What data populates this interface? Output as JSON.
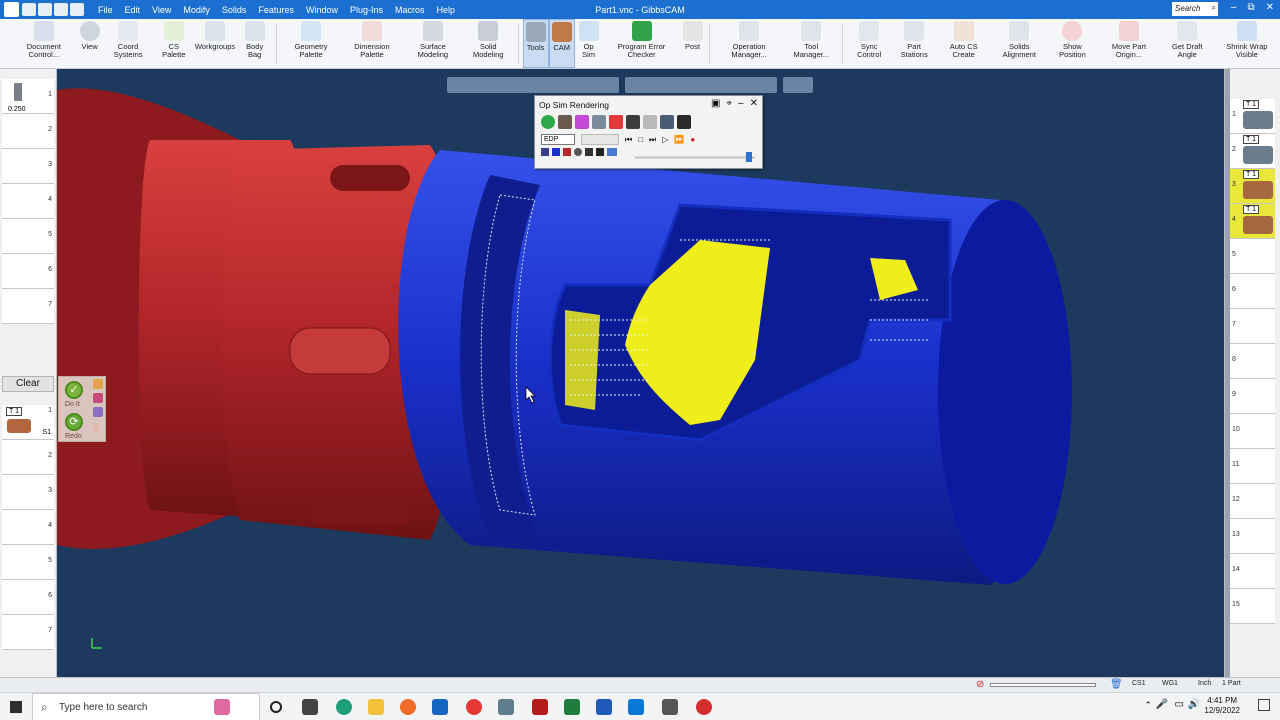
{
  "titlebar": {
    "window_title": "Part1.vnc - GibbsCAM",
    "menu": [
      "File",
      "Edit",
      "View",
      "Modify",
      "Solids",
      "Features",
      "Window",
      "Plug-Ins",
      "Macros",
      "Help"
    ],
    "search_placeholder": "Search"
  },
  "ribbon": {
    "buttons": [
      {
        "label": "Document Control...",
        "icon": "document-icon"
      },
      {
        "label": "View",
        "icon": "view-icon"
      },
      {
        "label": "Coord Systems",
        "icon": "coord-icon"
      },
      {
        "label": "CS Palette",
        "icon": "cs-palette-icon"
      },
      {
        "label": "Workgroups",
        "icon": "workgroups-icon"
      },
      {
        "label": "Body Bag",
        "icon": "body-bag-icon"
      },
      {
        "label": "Geometry Palette",
        "icon": "geometry-icon"
      },
      {
        "label": "Dimension Palette",
        "icon": "dimension-icon"
      },
      {
        "label": "Surface Modeling",
        "icon": "surface-icon"
      },
      {
        "label": "Solid Modeling",
        "icon": "solid-icon"
      },
      {
        "label": "Tools",
        "icon": "tools-icon"
      },
      {
        "label": "CAM",
        "icon": "cam-icon"
      },
      {
        "label": "Op Sim",
        "icon": "opsim-icon"
      },
      {
        "label": "Program Error Checker",
        "icon": "checker-icon"
      },
      {
        "label": "Post",
        "icon": "post-icon"
      },
      {
        "label": "Operation Manager...",
        "icon": "op-manager-icon"
      },
      {
        "label": "Tool Manager...",
        "icon": "tool-manager-icon"
      },
      {
        "label": "Sync Control",
        "icon": "sync-icon"
      },
      {
        "label": "Part Stations",
        "icon": "part-stations-icon"
      },
      {
        "label": "Auto CS Create",
        "icon": "auto-cs-icon"
      },
      {
        "label": "Solids Alignment",
        "icon": "align-icon"
      },
      {
        "label": "Show Position",
        "icon": "crosshair-icon"
      },
      {
        "label": "Move Part Origin...",
        "icon": "move-origin-icon"
      },
      {
        "label": "Get Draft Angle",
        "icon": "draft-icon"
      },
      {
        "label": "Shrink Wrap Visible",
        "icon": "shrink-wrap-icon"
      }
    ]
  },
  "left_panel": {
    "tool_diameter": "0.250",
    "slot_numbers": [
      "1",
      "2",
      "3",
      "4",
      "5",
      "6",
      "7"
    ],
    "clear_label": "Clear",
    "lower_slot_numbers": [
      "1",
      "2",
      "3",
      "4",
      "5",
      "6",
      "7"
    ],
    "tool_label": "T 1",
    "spindle_label": "S1"
  },
  "doit": {
    "do_it_label": "Do It",
    "redo_label": "Redo"
  },
  "right_panel": {
    "slots": [
      {
        "num": "1",
        "tool": "T 1",
        "color": "#ffffff"
      },
      {
        "num": "2",
        "tool": "T 1",
        "color": "#ffffff"
      },
      {
        "num": "3",
        "tool": "T 1",
        "color": "#e9e83a"
      },
      {
        "num": "4",
        "tool": "T 1",
        "color": "#e9e83a"
      },
      {
        "num": "5",
        "tool": "",
        "color": "#ffffff"
      },
      {
        "num": "6",
        "tool": "",
        "color": "#ffffff"
      },
      {
        "num": "7",
        "tool": "",
        "color": "#ffffff"
      },
      {
        "num": "8",
        "tool": "",
        "color": "#ffffff"
      },
      {
        "num": "9",
        "tool": "",
        "color": "#ffffff"
      },
      {
        "num": "10",
        "tool": "",
        "color": "#ffffff"
      },
      {
        "num": "11",
        "tool": "",
        "color": "#ffffff"
      },
      {
        "num": "12",
        "tool": "",
        "color": "#ffffff"
      },
      {
        "num": "13",
        "tool": "",
        "color": "#ffffff"
      },
      {
        "num": "14",
        "tool": "",
        "color": "#ffffff"
      },
      {
        "num": "15",
        "tool": "",
        "color": "#ffffff"
      }
    ]
  },
  "opsim": {
    "title": "Op Sim Rendering",
    "mode": "EDP",
    "progress": 0.95
  },
  "statusbar": {
    "cs": "CS1",
    "wg": "WG1",
    "units": "Inch",
    "part": "1 Part"
  },
  "taskbar": {
    "search_placeholder": "Type here to search",
    "time": "4:41 PM",
    "date": "12/9/2022"
  },
  "colors": {
    "viewport_bg": "#1d3a5e",
    "chuck_red": "#b3262b",
    "part_blue": "#1a2fc9",
    "machined_yellow": "#f0ee1a",
    "titlebar": "#1a6fd0"
  }
}
